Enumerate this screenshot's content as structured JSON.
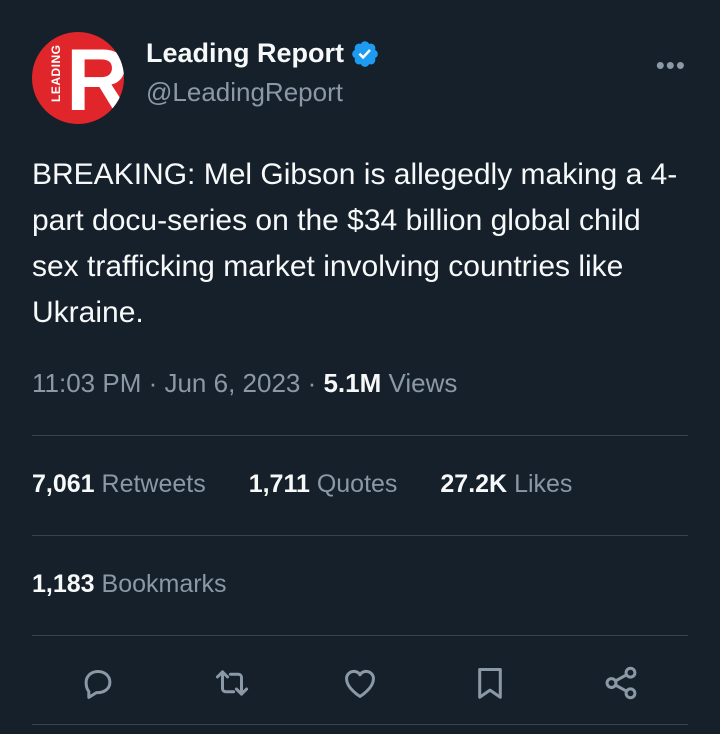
{
  "author": {
    "display_name": "Leading Report",
    "handle": "@LeadingReport",
    "avatar_letter": "R",
    "avatar_text": "LEADING",
    "avatar_color": "#e0262b",
    "verified_color": "#1d9bf0"
  },
  "tweet": {
    "text": "BREAKING: Mel Gibson is allegedly making a 4-part docu-series on the $34 billion global child sex trafficking market involving countries like Ukraine."
  },
  "meta": {
    "time": "11:03 PM",
    "separator": " · ",
    "date": "Jun 6, 2023",
    "views_count": "5.1M",
    "views_label": "Views"
  },
  "stats": {
    "retweets_count": "7,061",
    "retweets_label": "Retweets",
    "quotes_count": "1,711",
    "quotes_label": "Quotes",
    "likes_count": "27.2K",
    "likes_label": "Likes",
    "bookmarks_count": "1,183",
    "bookmarks_label": "Bookmarks"
  },
  "actions": [
    "reply-icon",
    "retweet-icon",
    "like-icon",
    "bookmark-icon",
    "share-icon"
  ],
  "colors": {
    "background": "#15202b",
    "text": "#f7f9f9",
    "secondary": "#8b98a5",
    "divider": "#38444d"
  }
}
